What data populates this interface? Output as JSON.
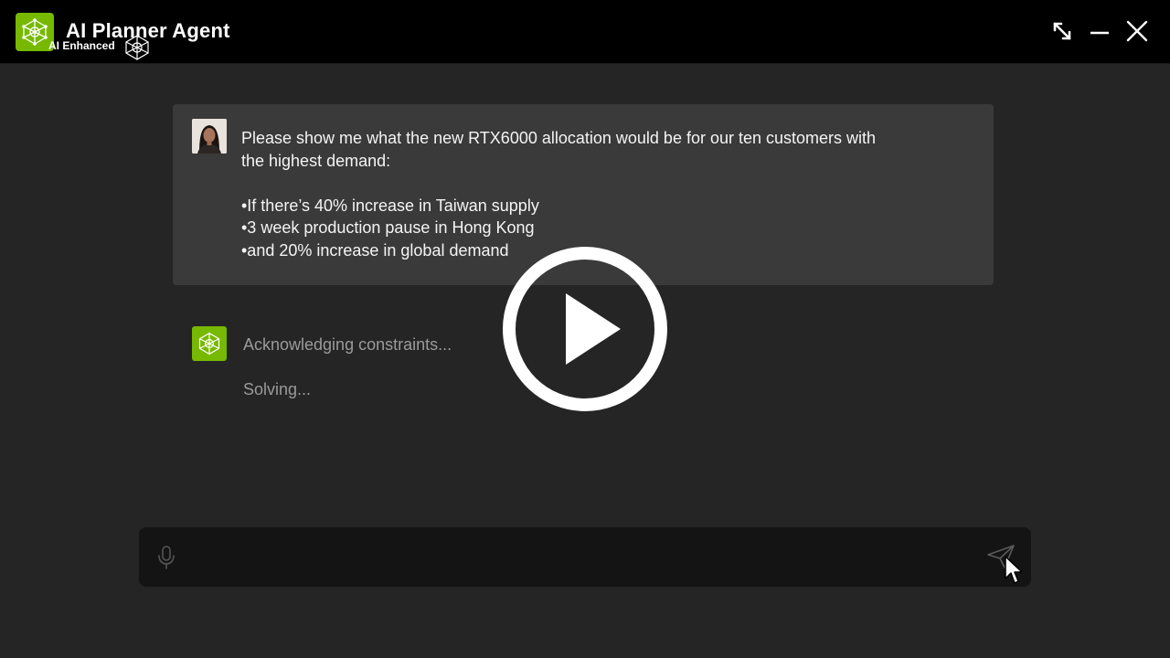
{
  "window": {
    "title": "AI Planner Agent",
    "subtitle": "AI Enhanced",
    "controls": [
      "expand-icon",
      "minimize-icon",
      "close-icon"
    ]
  },
  "colors": {
    "accent": "#76b900",
    "background": "#252525",
    "titlebar": "#000000",
    "bubble": "#3a3a3a",
    "input": "#141414",
    "status_text": "#9a9a9a"
  },
  "conversation": {
    "user_message": {
      "line1": "Please show me what the new RTX6000 allocation would be for our ten customers with",
      "line2": "the highest demand:",
      "bullets": [
        "•If there’s 40% increase in Taiwan supply",
        "•3 week production pause in Hong Kong",
        "•and 20% increase in global demand"
      ]
    },
    "agent_status": [
      "Acknowledging constraints...",
      "Solving..."
    ]
  },
  "input": {
    "placeholder": "",
    "mic_icon": "microphone-icon",
    "send_icon": "send-icon"
  },
  "overlay": {
    "icon": "play-icon"
  }
}
